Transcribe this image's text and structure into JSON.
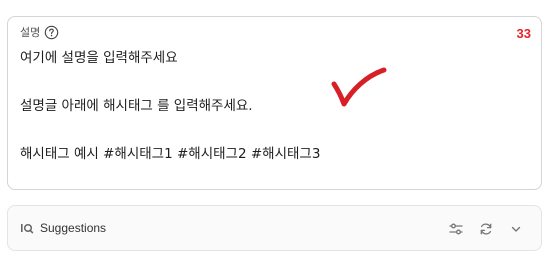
{
  "description": {
    "label": "설명",
    "char_count": "33",
    "lines": [
      "여기에 설명을 입력해주세요",
      "",
      "설명글 아래에 해시태그 를 입력해주세요.",
      "",
      "해시태그 예시 #해시태그1 #해시태그2 #해시태그3"
    ]
  },
  "suggestions": {
    "label": "Suggestions"
  },
  "icons": {
    "help": "question-circle-icon",
    "suggestions": "iq-icon",
    "filter": "sliders-icon",
    "refresh": "refresh-icon",
    "expand": "chevron-down-icon",
    "annotation": "red-checkmark"
  },
  "colors": {
    "count": "#e5252a",
    "checkmark": "#d61f26",
    "border": "#d4d4d8"
  }
}
